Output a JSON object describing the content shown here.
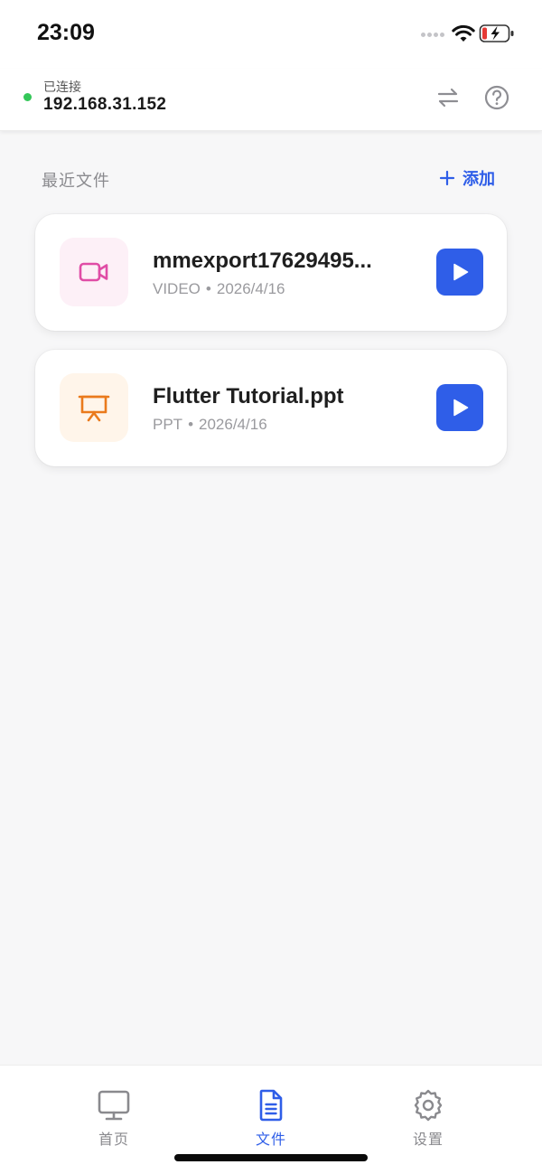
{
  "status_bar": {
    "time": "23:09",
    "icons": [
      "cellular-dots-icon",
      "wifi-icon",
      "battery-charging-icon"
    ]
  },
  "header": {
    "connection_status": "已连接",
    "connection_color": "#34c759",
    "ip_address": "192.168.31.152",
    "actions": [
      "swap-icon",
      "help-icon"
    ]
  },
  "section": {
    "title": "最近文件",
    "add_label": "添加"
  },
  "files": [
    {
      "name": "mmexport17629495...",
      "type": "VIDEO",
      "separator": "•",
      "date": "2026/4/16",
      "icon": "video-camera-icon",
      "icon_color": "#e04da6",
      "icon_bg": "#fdf0f7"
    },
    {
      "name": "Flutter Tutorial.ppt",
      "type": "PPT",
      "separator": "•",
      "date": "2026/4/16",
      "icon": "presentation-icon",
      "icon_color": "#ea7a1c",
      "icon_bg": "#fff5ea"
    }
  ],
  "bottom_nav": {
    "active": "文件",
    "accent": "#2f5ee8",
    "items": [
      {
        "label": "首页",
        "icon": "monitor-icon"
      },
      {
        "label": "文件",
        "icon": "document-icon"
      },
      {
        "label": "设置",
        "icon": "gear-icon"
      }
    ]
  }
}
